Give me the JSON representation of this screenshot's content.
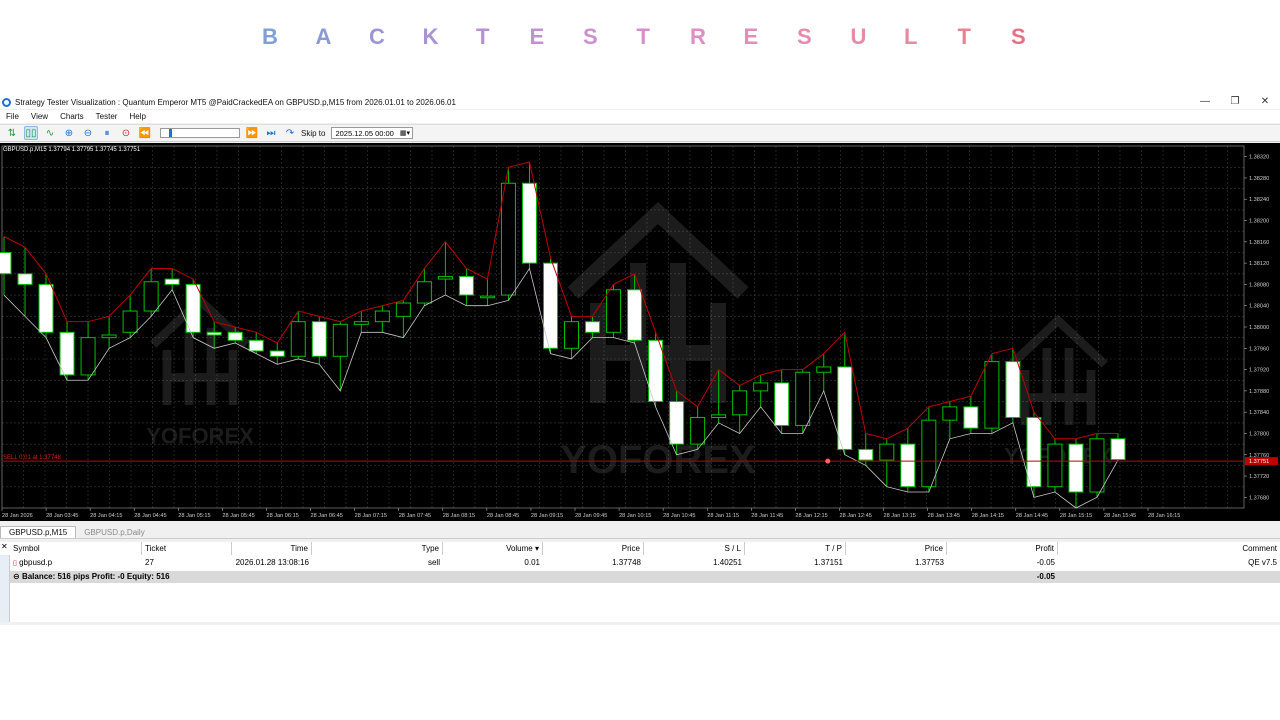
{
  "banner": {
    "letters": [
      "B",
      "A",
      "C",
      "K",
      "T",
      "E",
      "S",
      "T",
      "R",
      "E",
      "S",
      "U",
      "L",
      "T",
      "S"
    ],
    "colors": [
      "#7f9fd6",
      "#8a9ad6",
      "#9b97d6",
      "#aa92d6",
      "#b591d4",
      "#c291d2",
      "#cb90cf",
      "#d88fc9",
      "#de8ec2",
      "#e38db9",
      "#e68bb0",
      "#e98aa6",
      "#eb889d",
      "#ec8192",
      "#ea6f86"
    ]
  },
  "window": {
    "title": "Strategy Tester Visualization : Quantum Emperor MT5 @PaidCrackedEA on GBPUSD.p,M15 from 2026.01.01 to 2026.06.01",
    "controls": {
      "minimize": "—",
      "restore": "❐",
      "close": "✕"
    }
  },
  "menu": [
    "File",
    "View",
    "Charts",
    "Tester",
    "Help"
  ],
  "toolbar": {
    "skip_label": "Skip to",
    "skip_value": "2025.12.05 00:00"
  },
  "chart": {
    "symbol_info": "GBPUSD.p,M15  1.37794 1.37795 1.37745 1.37751",
    "position_label": "SELL 0.01 at 1.37748",
    "current_price": "1.37751",
    "watermark": "YOFOREX",
    "price_axis": [
      "1.38320",
      "1.38280",
      "1.38240",
      "1.38200",
      "1.38160",
      "1.38120",
      "1.38080",
      "1.38040",
      "1.38000",
      "1.37960",
      "1.37920",
      "1.37880",
      "1.37840",
      "1.37800",
      "1.37760",
      "1.37720",
      "1.37680"
    ],
    "time_axis": [
      "28 Jan 2026",
      "28 Jan 03:45",
      "28 Jan 04:15",
      "28 Jan 04:45",
      "28 Jan 05:15",
      "28 Jan 05:45",
      "28 Jan 06:15",
      "28 Jan 06:45",
      "28 Jan 07:15",
      "28 Jan 07:45",
      "28 Jan 08:15",
      "28 Jan 08:45",
      "28 Jan 09:15",
      "28 Jan 09:45",
      "28 Jan 10:15",
      "28 Jan 10:45",
      "28 Jan 11:15",
      "28 Jan 11:45",
      "28 Jan 12:15",
      "28 Jan 12:45",
      "28 Jan 13:15",
      "28 Jan 13:45",
      "28 Jan 14:15",
      "28 Jan 14:45",
      "28 Jan 15:15",
      "28 Jan 15:45",
      "28 Jan 16:15"
    ],
    "colors": {
      "bull": "#00c000",
      "bear_fill": "#ffffff",
      "upper_line": "#c00000",
      "lower_line": "#c8c8c8",
      "grid": "#3a3a3a",
      "position_line": "#c00000"
    }
  },
  "chart_data": {
    "type": "candlestick",
    "symbol": "GBPUSD.p",
    "timeframe": "M15",
    "ylim": [
      1.3766,
      1.3834
    ],
    "candles": [
      {
        "o": 1.3814,
        "h": 1.3817,
        "l": 1.3806,
        "c": 1.381
      },
      {
        "o": 1.381,
        "h": 1.3815,
        "l": 1.3802,
        "c": 1.3808
      },
      {
        "o": 1.3808,
        "h": 1.381,
        "l": 1.3798,
        "c": 1.3799
      },
      {
        "o": 1.3799,
        "h": 1.3801,
        "l": 1.379,
        "c": 1.3791
      },
      {
        "o": 1.3791,
        "h": 1.3801,
        "l": 1.379,
        "c": 1.3798
      },
      {
        "o": 1.3798,
        "h": 1.3802,
        "l": 1.3796,
        "c": 1.37985
      },
      {
        "o": 1.3799,
        "h": 1.3806,
        "l": 1.3798,
        "c": 1.3803
      },
      {
        "o": 1.3803,
        "h": 1.3811,
        "l": 1.3802,
        "c": 1.38085
      },
      {
        "o": 1.3809,
        "h": 1.3811,
        "l": 1.3807,
        "c": 1.3808
      },
      {
        "o": 1.3808,
        "h": 1.3809,
        "l": 1.3798,
        "c": 1.3799
      },
      {
        "o": 1.3799,
        "h": 1.3801,
        "l": 1.3796,
        "c": 1.37985
      },
      {
        "o": 1.3799,
        "h": 1.38,
        "l": 1.3797,
        "c": 1.37975
      },
      {
        "o": 1.37975,
        "h": 1.3799,
        "l": 1.3795,
        "c": 1.37955
      },
      {
        "o": 1.37955,
        "h": 1.3797,
        "l": 1.3793,
        "c": 1.37945
      },
      {
        "o": 1.37945,
        "h": 1.3803,
        "l": 1.3794,
        "c": 1.3801
      },
      {
        "o": 1.3801,
        "h": 1.3802,
        "l": 1.3793,
        "c": 1.37945
      },
      {
        "o": 1.37945,
        "h": 1.3801,
        "l": 1.3788,
        "c": 1.38005
      },
      {
        "o": 1.38005,
        "h": 1.3803,
        "l": 1.3799,
        "c": 1.3801
      },
      {
        "o": 1.3801,
        "h": 1.3804,
        "l": 1.3799,
        "c": 1.3803
      },
      {
        "o": 1.3802,
        "h": 1.3805,
        "l": 1.3798,
        "c": 1.38045
      },
      {
        "o": 1.38045,
        "h": 1.3811,
        "l": 1.3804,
        "c": 1.38085
      },
      {
        "o": 1.3809,
        "h": 1.3816,
        "l": 1.3806,
        "c": 1.38095
      },
      {
        "o": 1.38095,
        "h": 1.3811,
        "l": 1.3804,
        "c": 1.3806
      },
      {
        "o": 1.38055,
        "h": 1.3809,
        "l": 1.3804,
        "c": 1.38058
      },
      {
        "o": 1.3806,
        "h": 1.383,
        "l": 1.3805,
        "c": 1.3827
      },
      {
        "o": 1.3827,
        "h": 1.3831,
        "l": 1.3811,
        "c": 1.3812
      },
      {
        "o": 1.3812,
        "h": 1.3813,
        "l": 1.3795,
        "c": 1.3796
      },
      {
        "o": 1.3796,
        "h": 1.3802,
        "l": 1.3794,
        "c": 1.3801
      },
      {
        "o": 1.3801,
        "h": 1.3802,
        "l": 1.3798,
        "c": 1.3799
      },
      {
        "o": 1.3799,
        "h": 1.3808,
        "l": 1.3798,
        "c": 1.3807
      },
      {
        "o": 1.3807,
        "h": 1.381,
        "l": 1.3797,
        "c": 1.37975
      },
      {
        "o": 1.37975,
        "h": 1.3799,
        "l": 1.3785,
        "c": 1.3786
      },
      {
        "o": 1.3786,
        "h": 1.3788,
        "l": 1.3776,
        "c": 1.3778
      },
      {
        "o": 1.3778,
        "h": 1.3785,
        "l": 1.3777,
        "c": 1.3783
      },
      {
        "o": 1.3783,
        "h": 1.3792,
        "l": 1.3782,
        "c": 1.37835
      },
      {
        "o": 1.37835,
        "h": 1.3789,
        "l": 1.378,
        "c": 1.3788
      },
      {
        "o": 1.3788,
        "h": 1.3791,
        "l": 1.3785,
        "c": 1.37895
      },
      {
        "o": 1.37895,
        "h": 1.3792,
        "l": 1.378,
        "c": 1.37815
      },
      {
        "o": 1.37815,
        "h": 1.3792,
        "l": 1.378,
        "c": 1.37915
      },
      {
        "o": 1.37915,
        "h": 1.3795,
        "l": 1.3788,
        "c": 1.37925
      },
      {
        "o": 1.37925,
        "h": 1.3799,
        "l": 1.3776,
        "c": 1.3777
      },
      {
        "o": 1.3777,
        "h": 1.378,
        "l": 1.3774,
        "c": 1.3775
      },
      {
        "o": 1.3775,
        "h": 1.3779,
        "l": 1.377,
        "c": 1.3778
      },
      {
        "o": 1.3778,
        "h": 1.3781,
        "l": 1.3769,
        "c": 1.377
      },
      {
        "o": 1.377,
        "h": 1.3785,
        "l": 1.3769,
        "c": 1.37825
      },
      {
        "o": 1.37825,
        "h": 1.3786,
        "l": 1.3779,
        "c": 1.3785
      },
      {
        "o": 1.3785,
        "h": 1.3787,
        "l": 1.378,
        "c": 1.3781
      },
      {
        "o": 1.3781,
        "h": 1.3795,
        "l": 1.378,
        "c": 1.37935
      },
      {
        "o": 1.37935,
        "h": 1.3796,
        "l": 1.3782,
        "c": 1.3783
      },
      {
        "o": 1.3783,
        "h": 1.3784,
        "l": 1.3768,
        "c": 1.377
      },
      {
        "o": 1.377,
        "h": 1.3779,
        "l": 1.3769,
        "c": 1.3778
      },
      {
        "o": 1.3778,
        "h": 1.3779,
        "l": 1.3766,
        "c": 1.3769
      },
      {
        "o": 1.3769,
        "h": 1.378,
        "l": 1.3768,
        "c": 1.3779
      },
      {
        "o": 1.3779,
        "h": 1.378,
        "l": 1.3775,
        "c": 1.37751
      }
    ]
  },
  "tabs": [
    "GBPUSD.p,M15",
    "GBPUSD.p,Daily"
  ],
  "table": {
    "columns": [
      "Symbol",
      "Ticket",
      "Time",
      "Type",
      "Volume",
      "Price",
      "S / L",
      "T / P",
      "Price",
      "Profit",
      "Comment"
    ],
    "rows": [
      {
        "symbol": "gbpusd.p",
        "ticket": "27",
        "time": "2026.01.28 13:08:16",
        "type": "sell",
        "volume": "0.01",
        "price": "1.37748",
        "sl": "1.40251",
        "tp": "1.37151",
        "cur_price": "1.37753",
        "profit": "-0.05",
        "comment": "QE v7.5"
      }
    ],
    "balance_text": "Balance: 516 pips   Profit: -0   Equity: 516",
    "balance_profit": "-0.05"
  }
}
